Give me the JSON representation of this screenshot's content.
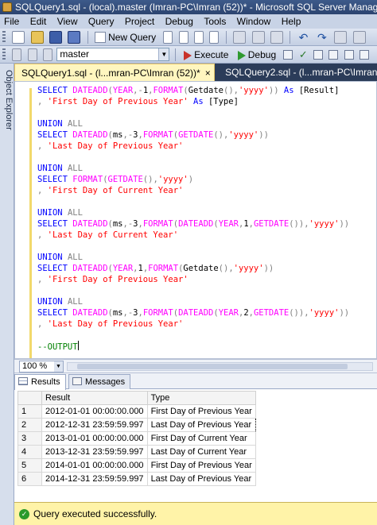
{
  "window": {
    "title": "SQLQuery1.sql - (local).master (Imran-PC\\Imran (52))* - Microsoft SQL Server Management Studio"
  },
  "menu": [
    "File",
    "Edit",
    "View",
    "Query",
    "Project",
    "Debug",
    "Tools",
    "Window",
    "Help"
  ],
  "toolbar": {
    "new_query_label": "New Query",
    "database": "master",
    "execute_label": "Execute",
    "debug_label": "Debug"
  },
  "side_panel": {
    "label": "Object Explorer"
  },
  "tabs": [
    {
      "label": "SQLQuery1.sql - (l...mran-PC\\Imran (52))*",
      "close": "×"
    },
    {
      "label": "SQLQuery2.sql - (l...mran-PC\\Imran (53))*"
    }
  ],
  "editor": {
    "lines": [
      [
        [
          "kw",
          "SELECT "
        ],
        [
          "fn",
          "DATEADD"
        ],
        [
          "gr",
          "("
        ],
        [
          "fn",
          "YEAR"
        ],
        [
          "gr",
          ",-"
        ],
        [
          "br",
          "1"
        ],
        [
          "gr",
          ","
        ],
        [
          "fn",
          "FORMAT"
        ],
        [
          "gr",
          "("
        ],
        [
          "br",
          "Getdate"
        ],
        [
          "gr",
          "(),"
        ],
        [
          "str",
          "'yyyy'"
        ],
        [
          "gr",
          "))"
        ],
        [
          "kw",
          " As "
        ],
        [
          "br",
          "[Result]"
        ]
      ],
      [
        [
          "gr",
          ", "
        ],
        [
          "str",
          "'First Day of Previous Year'"
        ],
        [
          "kw",
          " As "
        ],
        [
          "br",
          "[Type]"
        ]
      ],
      [],
      [
        [
          "kw",
          "UNION "
        ],
        [
          "gr",
          "ALL"
        ]
      ],
      [
        [
          "kw",
          "SELECT "
        ],
        [
          "fn",
          "DATEADD"
        ],
        [
          "gr",
          "("
        ],
        [
          "br",
          "ms"
        ],
        [
          "gr",
          ",-"
        ],
        [
          "br",
          "3"
        ],
        [
          "gr",
          ","
        ],
        [
          "fn",
          "FORMAT"
        ],
        [
          "gr",
          "("
        ],
        [
          "fn",
          "GETDATE"
        ],
        [
          "gr",
          "(),"
        ],
        [
          "str",
          "'yyyy'"
        ],
        [
          "gr",
          "))"
        ]
      ],
      [
        [
          "gr",
          ", "
        ],
        [
          "str",
          "'Last Day of Previous Year'"
        ]
      ],
      [],
      [
        [
          "kw",
          "UNION "
        ],
        [
          "gr",
          "ALL"
        ]
      ],
      [
        [
          "kw",
          "SELECT "
        ],
        [
          "fn",
          "FORMAT"
        ],
        [
          "gr",
          "("
        ],
        [
          "fn",
          "GETDATE"
        ],
        [
          "gr",
          "(),"
        ],
        [
          "str",
          "'yyyy'"
        ],
        [
          "gr",
          ")"
        ]
      ],
      [
        [
          "gr",
          ", "
        ],
        [
          "str",
          "'First Day of Current Year'"
        ]
      ],
      [],
      [
        [
          "kw",
          "UNION "
        ],
        [
          "gr",
          "ALL"
        ]
      ],
      [
        [
          "kw",
          "SELECT "
        ],
        [
          "fn",
          "DATEADD"
        ],
        [
          "gr",
          "("
        ],
        [
          "br",
          "ms"
        ],
        [
          "gr",
          ",-"
        ],
        [
          "br",
          "3"
        ],
        [
          "gr",
          ","
        ],
        [
          "fn",
          "FORMAT"
        ],
        [
          "gr",
          "("
        ],
        [
          "fn",
          "DATEADD"
        ],
        [
          "gr",
          "("
        ],
        [
          "fn",
          "YEAR"
        ],
        [
          "gr",
          ","
        ],
        [
          "br",
          "1"
        ],
        [
          "gr",
          ","
        ],
        [
          "fn",
          "GETDATE"
        ],
        [
          "gr",
          "()),"
        ],
        [
          "str",
          "'yyyy'"
        ],
        [
          "gr",
          "))"
        ]
      ],
      [
        [
          "gr",
          ", "
        ],
        [
          "str",
          "'Last Day of Current Year'"
        ]
      ],
      [],
      [
        [
          "kw",
          "UNION "
        ],
        [
          "gr",
          "ALL"
        ]
      ],
      [
        [
          "kw",
          "SELECT "
        ],
        [
          "fn",
          "DATEADD"
        ],
        [
          "gr",
          "("
        ],
        [
          "fn",
          "YEAR"
        ],
        [
          "gr",
          ","
        ],
        [
          "br",
          "1"
        ],
        [
          "gr",
          ","
        ],
        [
          "fn",
          "FORMAT"
        ],
        [
          "gr",
          "("
        ],
        [
          "br",
          "Getdate"
        ],
        [
          "gr",
          "(),"
        ],
        [
          "str",
          "'yyyy'"
        ],
        [
          "gr",
          "))"
        ]
      ],
      [
        [
          "gr",
          ", "
        ],
        [
          "str",
          "'First Day of Previous Year'"
        ]
      ],
      [],
      [
        [
          "kw",
          "UNION "
        ],
        [
          "gr",
          "ALL"
        ]
      ],
      [
        [
          "kw",
          "SELECT "
        ],
        [
          "fn",
          "DATEADD"
        ],
        [
          "gr",
          "("
        ],
        [
          "br",
          "ms"
        ],
        [
          "gr",
          ",-"
        ],
        [
          "br",
          "3"
        ],
        [
          "gr",
          ","
        ],
        [
          "fn",
          "FORMAT"
        ],
        [
          "gr",
          "("
        ],
        [
          "fn",
          "DATEADD"
        ],
        [
          "gr",
          "("
        ],
        [
          "fn",
          "YEAR"
        ],
        [
          "gr",
          ","
        ],
        [
          "br",
          "2"
        ],
        [
          "gr",
          ","
        ],
        [
          "fn",
          "GETDATE"
        ],
        [
          "gr",
          "()),"
        ],
        [
          "str",
          "'yyyy'"
        ],
        [
          "gr",
          "))"
        ]
      ],
      [
        [
          "gr",
          ", "
        ],
        [
          "str",
          "'Last Day of Previous Year'"
        ]
      ],
      [],
      [
        [
          "cm",
          "--OUTPUT"
        ]
      ]
    ]
  },
  "zoom": "100 %",
  "results_tabs": {
    "results": "Results",
    "messages": "Messages"
  },
  "results": {
    "columns": [
      "Result",
      "Type"
    ],
    "rows": [
      [
        "1",
        "2012-01-01 00:00:00.000",
        "First Day of Previous Year"
      ],
      [
        "2",
        "2012-12-31 23:59:59.997",
        "Last Day of Previous Year"
      ],
      [
        "3",
        "2013-01-01 00:00:00.000",
        "First Day of Current Year"
      ],
      [
        "4",
        "2013-12-31 23:59:59.997",
        "Last Day of Current Year"
      ],
      [
        "5",
        "2014-01-01 00:00:00.000",
        "First Day of Previous Year"
      ],
      [
        "6",
        "2014-12-31 23:59:59.997",
        "Last Day of Previous Year"
      ]
    ]
  },
  "status": {
    "message": "Query executed successfully."
  }
}
